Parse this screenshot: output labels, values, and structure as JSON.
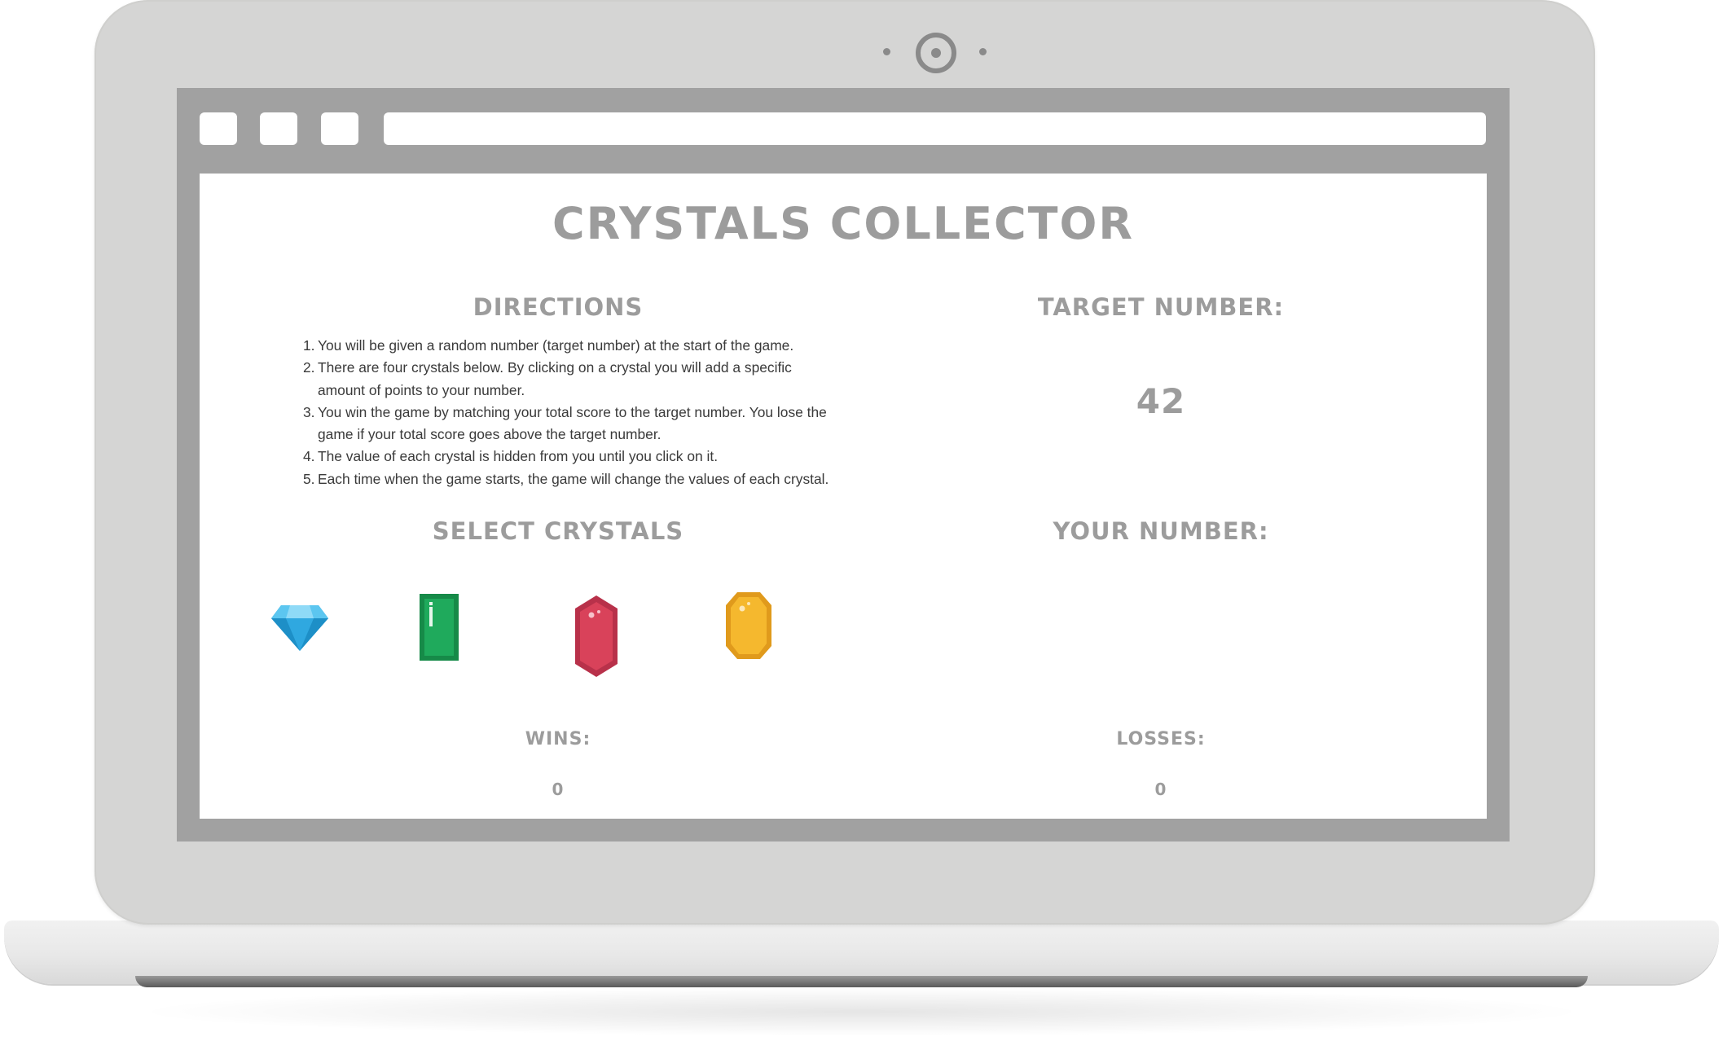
{
  "game": {
    "title": "Crystals Collector",
    "directions_heading": "Directions",
    "directions": [
      {
        "num": "1.",
        "text": "You will be given a random number (target number) at the start of the game."
      },
      {
        "num": "2.",
        "text": "There are four crystals below. By clicking on a crystal you will add a specific amount of points to your number."
      },
      {
        "num": "3.",
        "text": "You win the game by matching your total score to the target number. You lose the game if your total score goes above the target number."
      },
      {
        "num": "4.",
        "text": "The value of each crystal is hidden from you until you click on it."
      },
      {
        "num": "5.",
        "text": "Each time when the game starts, the game will change the values of each crystal."
      }
    ],
    "select_heading": "Select Crystals",
    "target_heading": "Target Number:",
    "target_value": "42",
    "your_heading": "Your Number:",
    "your_value": "",
    "wins_heading": "Wins:",
    "wins_value": "0",
    "losses_heading": "Losses:",
    "losses_value": "0",
    "crystals": [
      {
        "name": "blue-diamond-crystal-icon",
        "color": "#2fa8e0"
      },
      {
        "name": "green-emerald-crystal-icon",
        "color": "#1faa5c"
      },
      {
        "name": "red-ruby-crystal-icon",
        "color": "#d9425a"
      },
      {
        "name": "yellow-topaz-crystal-icon",
        "color": "#f5b82e"
      }
    ]
  },
  "colors": {
    "heading": "#9c9c9c",
    "body_text": "#3a3a3a",
    "browser_frame": "#a1a1a1",
    "laptop_body": "#d5d5d4"
  }
}
